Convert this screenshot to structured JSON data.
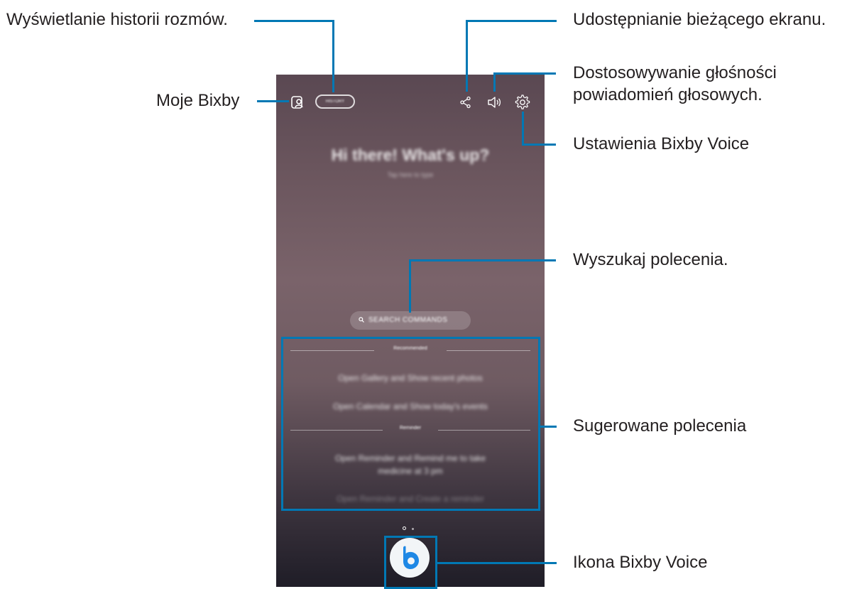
{
  "phone": {
    "history_button": "HISTORY",
    "greeting": "Hi there! What's up?",
    "greeting_sub": "Tap here to type",
    "search_label": "SEARCH COMMANDS",
    "section_recommended": "Recommended",
    "command_1": "Open Gallery and Show recent photos",
    "command_2": "Open Calendar and Show today's events",
    "section_reminder": "Reminder",
    "command_3_line1": "Open Reminder and Remind me to take",
    "command_3_line2": "medicine at 3 pm",
    "command_4": "Open Reminder and Create a reminder",
    "icons": [
      "profile-icon",
      "share-icon",
      "volume-icon",
      "gear-icon",
      "search-icon",
      "bixby-voice-icon"
    ],
    "page_indicator": {
      "count": 2,
      "active": 0
    }
  },
  "callouts": {
    "history": "Wyświetlanie historii rozmów.",
    "my_bixby": "Moje Bixby",
    "share": "Udostępnianie bieżącego ekranu.",
    "volume_line1": "Dostosowywanie głośności",
    "volume_line2": "powiadomień głosowych.",
    "settings": "Ustawienia Bixby Voice",
    "search": "Wyszukaj polecenia.",
    "suggested": "Sugerowane polecenia",
    "bixby_icon": "Ikona Bixby Voice"
  },
  "colors": {
    "callout": "#0078b4",
    "bixby_blue": "#1e88e5"
  }
}
